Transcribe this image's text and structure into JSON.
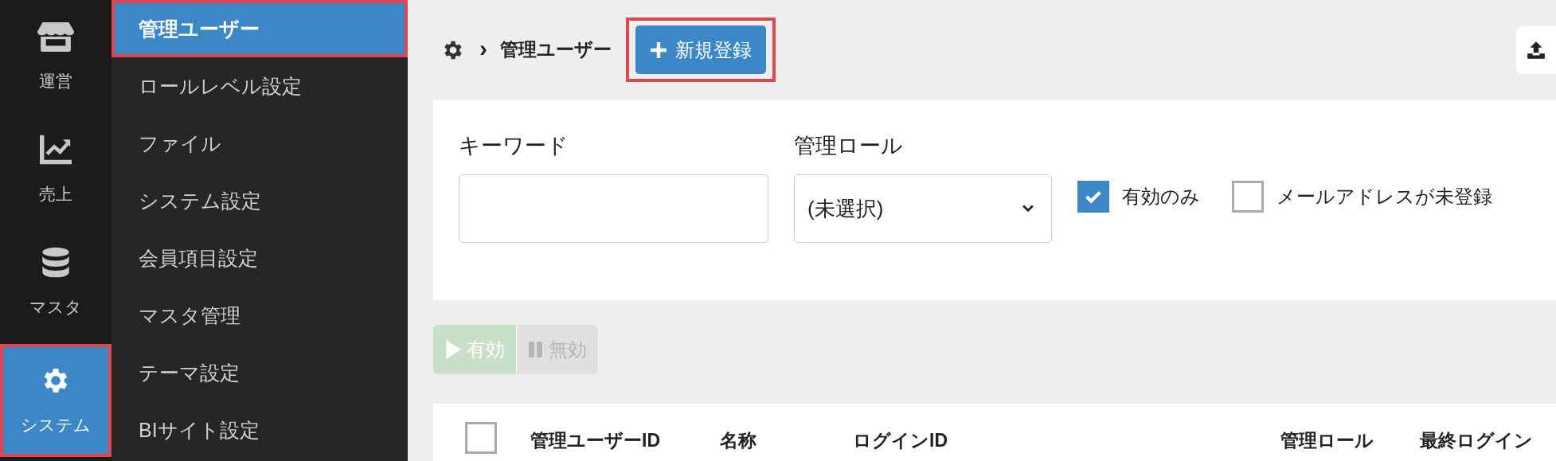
{
  "rail": [
    {
      "label": "運営",
      "kind": "store",
      "selected": false,
      "highlighted": false
    },
    {
      "label": "売上",
      "kind": "chart",
      "selected": false,
      "highlighted": false
    },
    {
      "label": "マスタ",
      "kind": "database",
      "selected": false,
      "highlighted": false
    },
    {
      "label": "システム",
      "kind": "gear",
      "selected": true,
      "highlighted": true
    }
  ],
  "submenu": [
    {
      "label": "管理ユーザー",
      "selected": true,
      "highlighted": true
    },
    {
      "label": "ロールレベル設定",
      "selected": false,
      "highlighted": false
    },
    {
      "label": "ファイル",
      "selected": false,
      "highlighted": false
    },
    {
      "label": "システム設定",
      "selected": false,
      "highlighted": false
    },
    {
      "label": "会員項目設定",
      "selected": false,
      "highlighted": false
    },
    {
      "label": "マスタ管理",
      "selected": false,
      "highlighted": false
    },
    {
      "label": "テーマ設定",
      "selected": false,
      "highlighted": false
    },
    {
      "label": "BIサイト設定",
      "selected": false,
      "highlighted": false
    }
  ],
  "breadcrumb": {
    "separator": "›",
    "label": "管理ユーザー"
  },
  "new_button": {
    "label": "新規登録",
    "highlighted": true
  },
  "filters": {
    "keyword": {
      "label": "キーワード"
    },
    "role": {
      "label": "管理ロール",
      "value": "(未選択)"
    },
    "checkboxes": [
      {
        "label": "有効のみ",
        "checked": true
      },
      {
        "label": "メールアドレスが未登録",
        "checked": false
      }
    ]
  },
  "actions": [
    {
      "label": "有効",
      "kind": "play"
    },
    {
      "label": "無効",
      "kind": "pause"
    }
  ],
  "table": {
    "select_all": {
      "checked": false
    },
    "columns": [
      "管理ユーザーID",
      "名称",
      "ログインID",
      "管理ロール",
      "最終ログイン"
    ]
  }
}
